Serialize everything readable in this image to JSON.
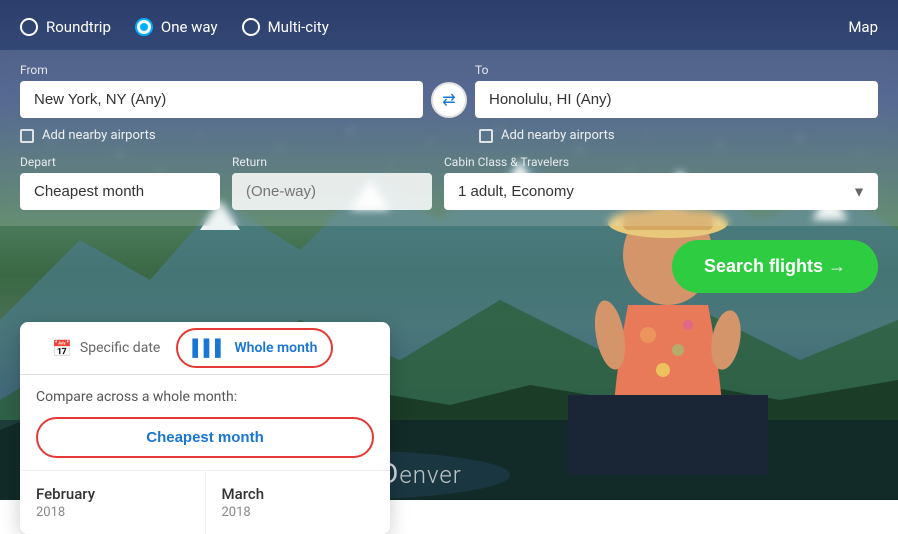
{
  "background": {
    "colors": {
      "sky_top": "#1a2a4a",
      "sky_mid": "#2c4a7a",
      "mountain": "#2a5a3a"
    }
  },
  "top_bar": {
    "trip_types": [
      {
        "id": "roundtrip",
        "label": "Roundtrip",
        "selected": false
      },
      {
        "id": "oneway",
        "label": "One way",
        "selected": true
      },
      {
        "id": "multicity",
        "label": "Multi-city",
        "selected": false
      }
    ],
    "map_label": "Map"
  },
  "search_form": {
    "from_label": "From",
    "from_value": "New York, NY (Any)",
    "to_label": "To",
    "to_value": "Honolulu, HI (Any)",
    "swap_icon": "⇄",
    "nearby_left_label": "Add nearby airports",
    "nearby_right_label": "Add nearby airports",
    "depart_label": "Depart",
    "depart_value": "Cheapest month",
    "return_label": "Return",
    "return_placeholder": "(One-way)",
    "cabin_label": "Cabin Class & Travelers",
    "cabin_value": "1 adult, Economy",
    "search_label": "Search flights →"
  },
  "dropdown": {
    "tab_specific": "Specific date",
    "tab_calendar_icon": "📅",
    "tab_whole_month": "Whole month",
    "tab_bar_icon": "▌▌▌",
    "compare_text": "Compare across a whole month:",
    "cheapest_btn_label": "Cheapest month",
    "months": [
      {
        "name": "February",
        "year": "2018"
      },
      {
        "name": "March",
        "year": "2018"
      }
    ]
  },
  "footer": {
    "city": "enver"
  }
}
